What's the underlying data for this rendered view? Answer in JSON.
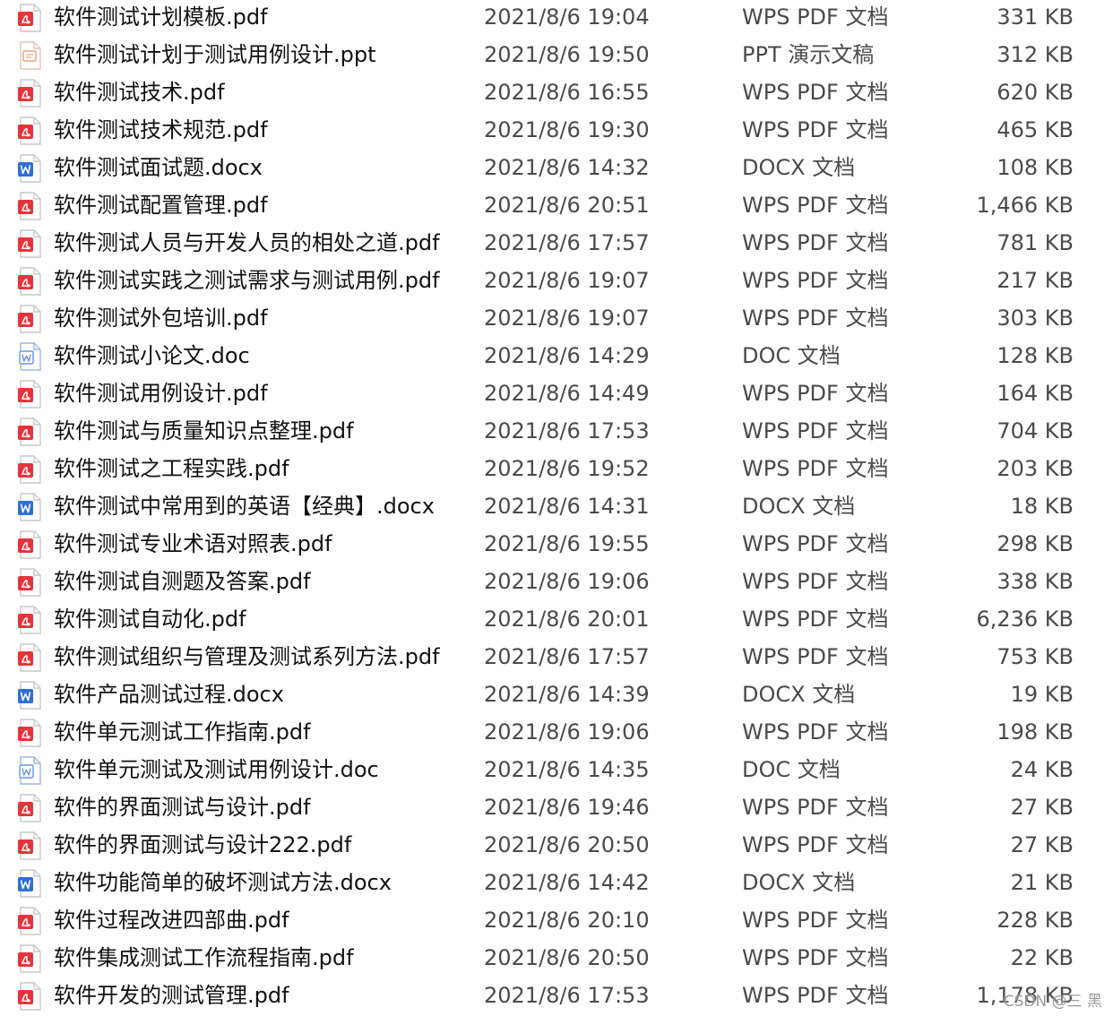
{
  "files": [
    {
      "name": "软件测试计划模板.pdf",
      "modified": "2021/8/6 19:04",
      "type": "WPS PDF 文档",
      "size": "331 KB",
      "icon": "pdf-icon"
    },
    {
      "name": "软件测试计划于测试用例设计.ppt",
      "modified": "2021/8/6 19:50",
      "type": "PPT 演示文稿",
      "size": "312 KB",
      "icon": "ppt-icon"
    },
    {
      "name": "软件测试技术.pdf",
      "modified": "2021/8/6 16:55",
      "type": "WPS PDF 文档",
      "size": "620 KB",
      "icon": "pdf-icon"
    },
    {
      "name": "软件测试技术规范.pdf",
      "modified": "2021/8/6 19:30",
      "type": "WPS PDF 文档",
      "size": "465 KB",
      "icon": "pdf-icon"
    },
    {
      "name": "软件测试面试题.docx",
      "modified": "2021/8/6 14:32",
      "type": "DOCX 文档",
      "size": "108 KB",
      "icon": "docx-icon"
    },
    {
      "name": "软件测试配置管理.pdf",
      "modified": "2021/8/6 20:51",
      "type": "WPS PDF 文档",
      "size": "1,466 KB",
      "icon": "pdf-icon"
    },
    {
      "name": "软件测试人员与开发人员的相处之道.pdf",
      "modified": "2021/8/6 17:57",
      "type": "WPS PDF 文档",
      "size": "781 KB",
      "icon": "pdf-icon"
    },
    {
      "name": "软件测试实践之测试需求与测试用例.pdf",
      "modified": "2021/8/6 19:07",
      "type": "WPS PDF 文档",
      "size": "217 KB",
      "icon": "pdf-icon"
    },
    {
      "name": "软件测试外包培训.pdf",
      "modified": "2021/8/6 19:07",
      "type": "WPS PDF 文档",
      "size": "303 KB",
      "icon": "pdf-icon"
    },
    {
      "name": "软件测试小论文.doc",
      "modified": "2021/8/6 14:29",
      "type": "DOC 文档",
      "size": "128 KB",
      "icon": "doc-icon"
    },
    {
      "name": "软件测试用例设计.pdf",
      "modified": "2021/8/6 14:49",
      "type": "WPS PDF 文档",
      "size": "164 KB",
      "icon": "pdf-icon"
    },
    {
      "name": "软件测试与质量知识点整理.pdf",
      "modified": "2021/8/6 17:53",
      "type": "WPS PDF 文档",
      "size": "704 KB",
      "icon": "pdf-icon"
    },
    {
      "name": "软件测试之工程实践.pdf",
      "modified": "2021/8/6 19:52",
      "type": "WPS PDF 文档",
      "size": "203 KB",
      "icon": "pdf-icon"
    },
    {
      "name": "软件测试中常用到的英语【经典】.docx",
      "modified": "2021/8/6 14:31",
      "type": "DOCX 文档",
      "size": "18 KB",
      "icon": "docx-icon"
    },
    {
      "name": "软件测试专业术语对照表.pdf",
      "modified": "2021/8/6 19:55",
      "type": "WPS PDF 文档",
      "size": "298 KB",
      "icon": "pdf-icon"
    },
    {
      "name": "软件测试自测题及答案.pdf",
      "modified": "2021/8/6 19:06",
      "type": "WPS PDF 文档",
      "size": "338 KB",
      "icon": "pdf-icon"
    },
    {
      "name": "软件测试自动化.pdf",
      "modified": "2021/8/6 20:01",
      "type": "WPS PDF 文档",
      "size": "6,236 KB",
      "icon": "pdf-icon"
    },
    {
      "name": "软件测试组织与管理及测试系列方法.pdf",
      "modified": "2021/8/6 17:57",
      "type": "WPS PDF 文档",
      "size": "753 KB",
      "icon": "pdf-icon"
    },
    {
      "name": "软件产品测试过程.docx",
      "modified": "2021/8/6 14:39",
      "type": "DOCX 文档",
      "size": "19 KB",
      "icon": "docx-icon"
    },
    {
      "name": "软件单元测试工作指南.pdf",
      "modified": "2021/8/6 19:06",
      "type": "WPS PDF 文档",
      "size": "198 KB",
      "icon": "pdf-icon"
    },
    {
      "name": "软件单元测试及测试用例设计.doc",
      "modified": "2021/8/6 14:35",
      "type": "DOC 文档",
      "size": "24 KB",
      "icon": "doc-icon"
    },
    {
      "name": "软件的界面测试与设计.pdf",
      "modified": "2021/8/6 19:46",
      "type": "WPS PDF 文档",
      "size": "27 KB",
      "icon": "pdf-icon"
    },
    {
      "name": "软件的界面测试与设计222.pdf",
      "modified": "2021/8/6 20:50",
      "type": "WPS PDF 文档",
      "size": "27 KB",
      "icon": "pdf-icon"
    },
    {
      "name": "软件功能简单的破坏测试方法.docx",
      "modified": "2021/8/6 14:42",
      "type": "DOCX 文档",
      "size": "21 KB",
      "icon": "docx-icon"
    },
    {
      "name": "软件过程改进四部曲.pdf",
      "modified": "2021/8/6 20:10",
      "type": "WPS PDF 文档",
      "size": "228 KB",
      "icon": "pdf-icon"
    },
    {
      "name": "软件集成测试工作流程指南.pdf",
      "modified": "2021/8/6 20:50",
      "type": "WPS PDF 文档",
      "size": "22 KB",
      "icon": "pdf-icon"
    },
    {
      "name": "软件开发的测试管理.pdf",
      "modified": "2021/8/6 17:53",
      "type": "WPS PDF 文档",
      "size": "1,178 KB",
      "icon": "pdf-icon"
    }
  ],
  "watermark": "CSDN @三 黑",
  "colors": {
    "pdf_accent": "#e5343a",
    "docx_accent": "#2f6fd6",
    "doc_accent": "#6a95d8",
    "ppt_accent": "#e8a07c"
  }
}
